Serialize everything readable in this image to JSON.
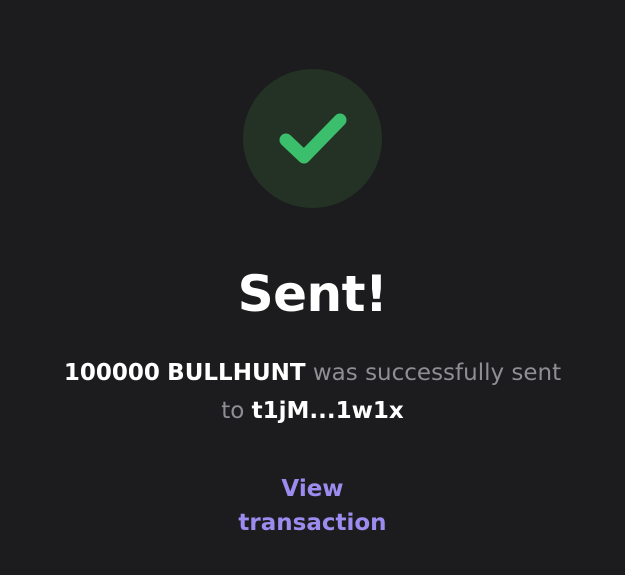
{
  "status": {
    "icon": "checkmark-icon",
    "accent_color": "#3bbf6c",
    "circle_color": "#243226"
  },
  "title": "Sent!",
  "message": {
    "amount": "100000",
    "token": "BULLHUNT",
    "middle_text": "was successfully sent to",
    "recipient": "t1jM...1w1x"
  },
  "link": {
    "label": "View transaction",
    "color": "#9d8cf0"
  }
}
